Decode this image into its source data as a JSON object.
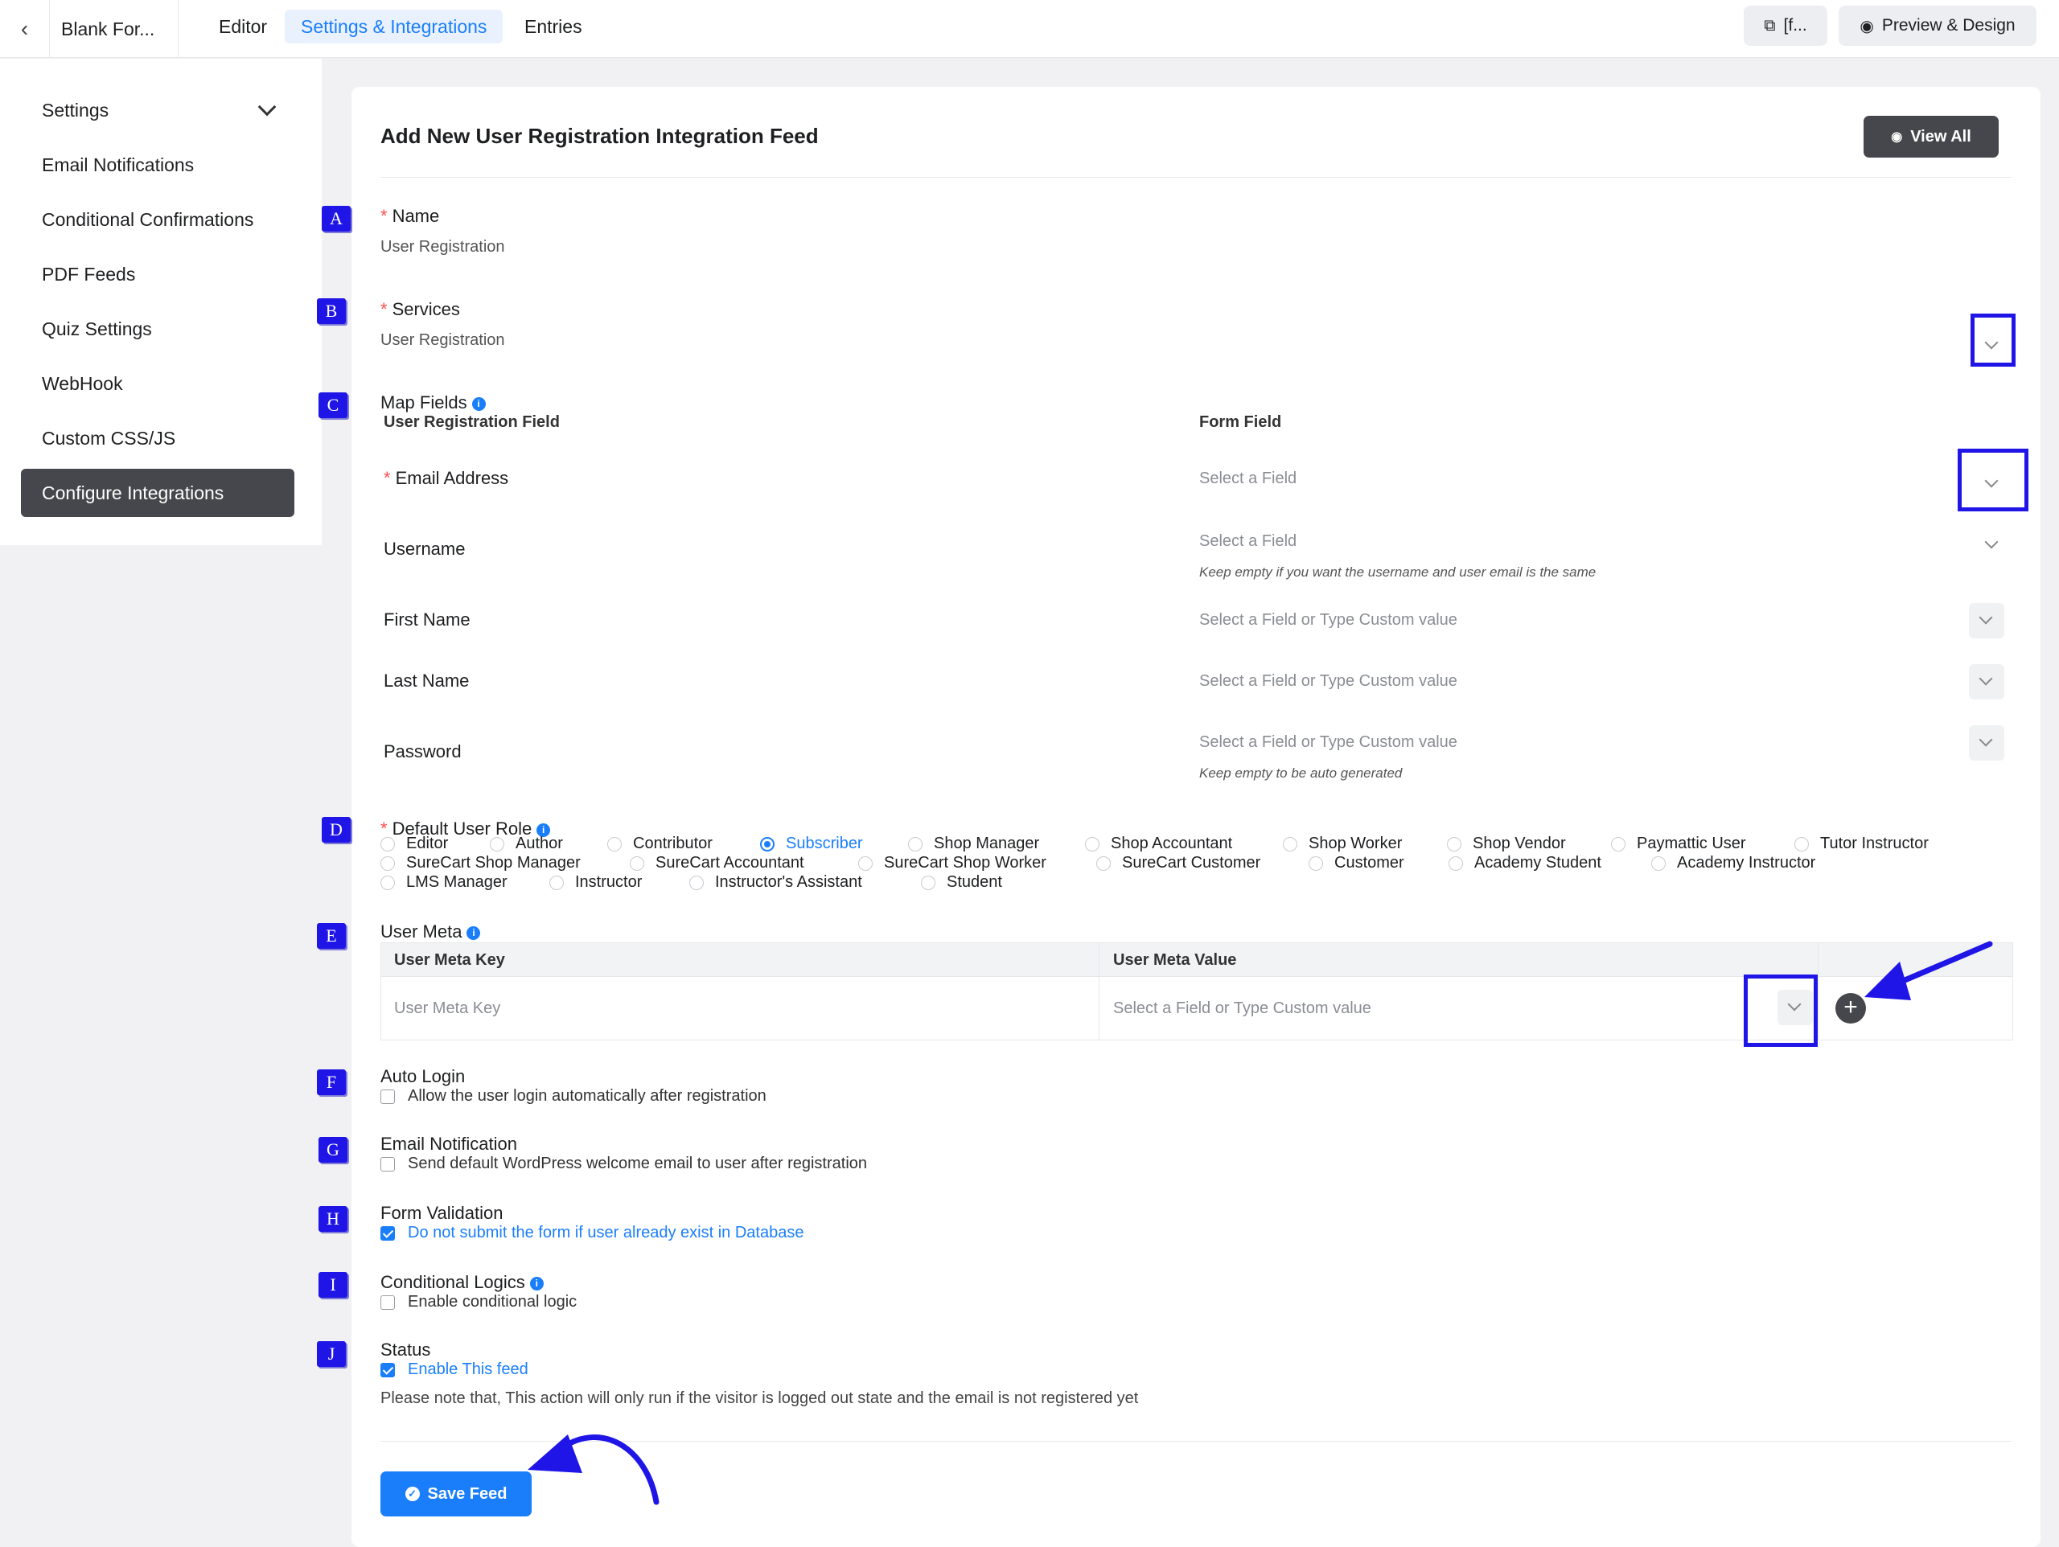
{
  "topbar": {
    "form_title": "Blank For...",
    "tabs": [
      {
        "label": "Editor",
        "active": false
      },
      {
        "label": "Settings & Integrations",
        "active": true
      },
      {
        "label": "Entries",
        "active": false
      }
    ],
    "shortcode_label": "[f...",
    "preview_label": "Preview & Design"
  },
  "sidebar": {
    "items": [
      {
        "label": "Settings"
      },
      {
        "label": "Email Notifications"
      },
      {
        "label": "Conditional Confirmations"
      },
      {
        "label": "PDF Feeds"
      },
      {
        "label": "Quiz Settings"
      },
      {
        "label": "WebHook"
      },
      {
        "label": "Custom CSS/JS"
      },
      {
        "label": "Configure Integrations",
        "active": true
      }
    ]
  },
  "main": {
    "title": "Add New User Registration Integration Feed",
    "view_all_label": "View All",
    "name": {
      "label": "Name",
      "value": "User Registration"
    },
    "services": {
      "label": "Services",
      "value": "User Registration"
    },
    "map_fields": {
      "label": "Map Fields",
      "col_left": "User Registration Field",
      "col_right": "Form Field",
      "rows": [
        {
          "label": "Email Address",
          "required": true,
          "placeholder": "Select a Field",
          "hint": ""
        },
        {
          "label": "Username",
          "required": false,
          "placeholder": "Select a Field",
          "hint": "Keep empty if you want the username and user email is the same"
        },
        {
          "label": "First Name",
          "required": false,
          "placeholder": "Select a Field or Type Custom value",
          "hint": ""
        },
        {
          "label": "Last Name",
          "required": false,
          "placeholder": "Select a Field or Type Custom value",
          "hint": ""
        },
        {
          "label": "Password",
          "required": false,
          "placeholder": "Select a Field or Type Custom value",
          "hint": "Keep empty to be auto generated"
        }
      ]
    },
    "user_role": {
      "label": "Default User Role",
      "selected": "Subscriber",
      "options": [
        "Editor",
        "Author",
        "Contributor",
        "Subscriber",
        "Shop Manager",
        "Shop Accountant",
        "Shop Worker",
        "Shop Vendor",
        "Paymattic User",
        "Tutor Instructor",
        "SureCart Shop Manager",
        "SureCart Accountant",
        "SureCart Shop Worker",
        "SureCart Customer",
        "Customer",
        "Academy Student",
        "Academy Instructor",
        "LMS Manager",
        "Instructor",
        "Instructor's Assistant",
        "Student"
      ]
    },
    "user_meta": {
      "label": "User Meta",
      "col_key": "User Meta Key",
      "col_value": "User Meta Value",
      "key_placeholder": "User Meta Key",
      "value_placeholder": "Select a Field or Type Custom value"
    },
    "auto_login": {
      "label": "Auto Login",
      "option": "Allow the user login automatically after registration",
      "checked": false
    },
    "email_notification": {
      "label": "Email Notification",
      "option": "Send default WordPress welcome email to user after registration",
      "checked": false
    },
    "form_validation": {
      "label": "Form Validation",
      "option": "Do not submit the form if user already exist in Database",
      "checked": true
    },
    "conditional_logics": {
      "label": "Conditional Logics",
      "option": "Enable conditional logic",
      "checked": false
    },
    "status": {
      "label": "Status",
      "option": "Enable This feed",
      "checked": true,
      "note": "Please note that, This action will only run if the visitor is logged out state and the email is not registered yet"
    },
    "save_label": "Save Feed"
  },
  "annotations": {
    "markers": [
      "A",
      "B",
      "C",
      "D",
      "E",
      "F",
      "G",
      "H",
      "I",
      "J"
    ],
    "color": "#1f15e6"
  }
}
